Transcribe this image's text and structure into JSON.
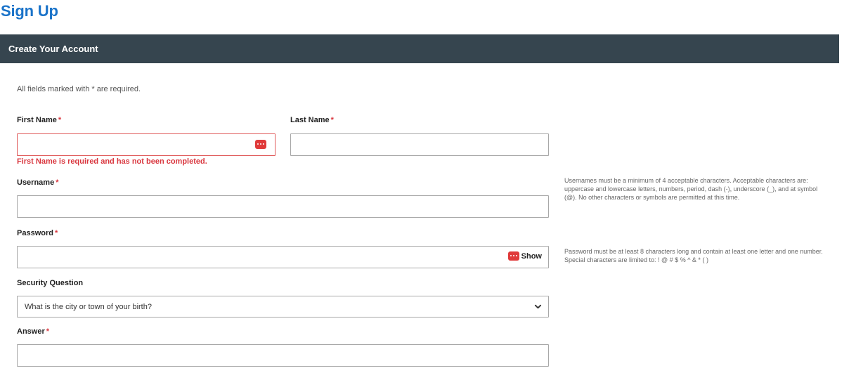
{
  "page": {
    "title": "Sign Up"
  },
  "card": {
    "title": "Create Your Account"
  },
  "form": {
    "required_note": "All fields marked with * are required.",
    "required_marker": "*",
    "first_name": {
      "label": "First Name",
      "value": "",
      "error": "First Name is required and has not been completed."
    },
    "last_name": {
      "label": "Last Name",
      "value": ""
    },
    "username": {
      "label": "Username",
      "value": "",
      "help": "Usernames must be a minimum of 4 acceptable characters. Acceptable characters are: uppercase and lowercase letters, numbers, period, dash (-), underscore (_), and at symbol (@). No other characters or symbols are permitted at this time."
    },
    "password": {
      "label": "Password",
      "value": "",
      "show_label": "Show",
      "help": "Password must be at least 8 characters long and contain at least one letter and one number. Special characters are limited to: ! @ # $ % ^ & * ( )"
    },
    "security_question": {
      "label": "Security Question",
      "selected": "What is the city or town of your birth?"
    },
    "answer": {
      "label": "Answer",
      "value": ""
    }
  },
  "colors": {
    "title": "#1a73c9",
    "header_bg": "#36454f",
    "error": "#d9363e"
  },
  "icons": {
    "field_action": "password-manager-icon",
    "dropdown": "chevron-down-icon"
  }
}
